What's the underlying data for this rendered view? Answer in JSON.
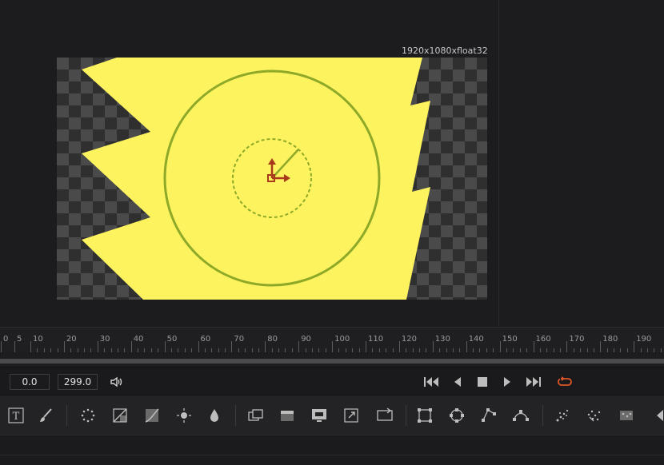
{
  "viewer": {
    "resolution_label": "1920x1080xfloat32"
  },
  "ruler": {
    "labels": [
      "0",
      "5",
      "10",
      "20",
      "30",
      "40",
      "50",
      "60",
      "70",
      "80",
      "90",
      "100",
      "110",
      "120",
      "130",
      "140",
      "150",
      "160",
      "170",
      "180",
      "190"
    ]
  },
  "transport": {
    "current_time": "0.0",
    "end_time": "299.0",
    "accent_color": "#e0572a"
  },
  "toolbar": {
    "tools": [
      "text-tool-icon",
      "paint-brush-icon",
      "particles-icon",
      "color-corrector-icon",
      "curves-icon",
      "brightness-icon",
      "blur-drop-icon",
      "merge-icon",
      "background-icon",
      "monitor-icon",
      "resize-icon",
      "transform-icon",
      "rectangle-mask-icon",
      "ellipse-mask-icon",
      "polygon-mask-icon",
      "bspline-mask-icon",
      "particle-emitter-icon",
      "particle-render-icon",
      "particle-force-icon",
      "more-tools-icon"
    ]
  },
  "colors": {
    "shape_fill": "#fdf35f",
    "shape_stroke": "#8ea827",
    "widget_red": "#a83a1b"
  }
}
